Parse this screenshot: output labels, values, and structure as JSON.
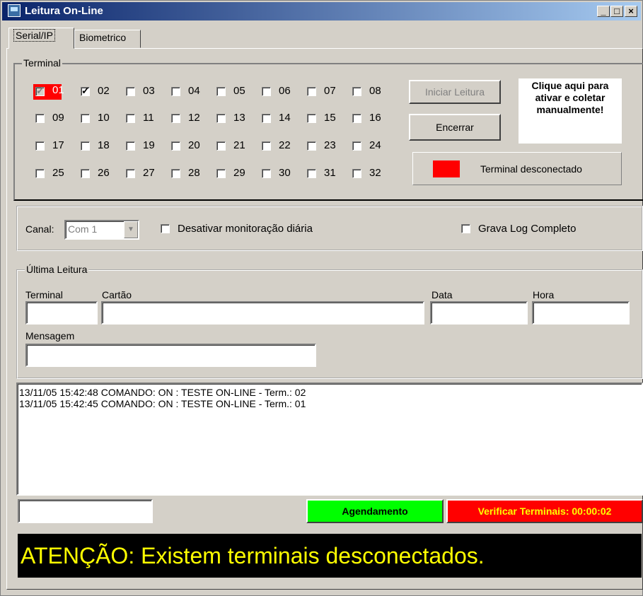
{
  "window": {
    "title": "Leitura On-Line"
  },
  "tabs": [
    {
      "label": "Serial/IP",
      "active": true
    },
    {
      "label": "Biometrico",
      "active": false
    }
  ],
  "terminal": {
    "legend": "Terminal",
    "items": [
      {
        "label": "01",
        "checked": true,
        "highlight": true
      },
      {
        "label": "02",
        "checked": true
      },
      {
        "label": "03"
      },
      {
        "label": "04"
      },
      {
        "label": "05"
      },
      {
        "label": "06"
      },
      {
        "label": "07"
      },
      {
        "label": "08"
      },
      {
        "label": "09"
      },
      {
        "label": "10"
      },
      {
        "label": "11"
      },
      {
        "label": "12"
      },
      {
        "label": "13"
      },
      {
        "label": "14"
      },
      {
        "label": "15"
      },
      {
        "label": "16"
      },
      {
        "label": "17"
      },
      {
        "label": "18"
      },
      {
        "label": "19"
      },
      {
        "label": "20"
      },
      {
        "label": "21"
      },
      {
        "label": "22"
      },
      {
        "label": "23"
      },
      {
        "label": "24"
      },
      {
        "label": "25"
      },
      {
        "label": "26"
      },
      {
        "label": "27"
      },
      {
        "label": "28"
      },
      {
        "label": "29"
      },
      {
        "label": "30"
      },
      {
        "label": "31"
      },
      {
        "label": "32"
      }
    ],
    "start_label": "Iniciar Leitura",
    "stop_label": "Encerrar",
    "manual_label": "Clique aqui para ativar e coletar manualmente!",
    "status_label": "Terminal desconectado",
    "status_color": "#ff0000"
  },
  "options": {
    "canal_label": "Canal:",
    "canal_value": "Com 1",
    "disable_label": "Desativar monitoração diária",
    "log_label": "Grava Log Completo"
  },
  "last_read": {
    "legend": "Última Leitura",
    "terminal_label": "Terminal",
    "card_label": "Cartão",
    "date_label": "Data",
    "time_label": "Hora",
    "message_label": "Mensagem"
  },
  "log_lines": [
    "13/11/05 15:42:48 COMANDO: ON : TESTE ON-LINE - Term.: 02",
    "13/11/05 15:42:45 COMANDO: ON : TESTE ON-LINE - Term.: 01"
  ],
  "footer": {
    "schedule_label": "Agendamento",
    "schedule_color": "#00ff00",
    "check_label": "Verificar Terminais: 00:00:02",
    "check_color": "#ff0000",
    "alert_text": "ATENÇÃO: Existem terminais desconectados.",
    "alert_color": "#ffff00"
  }
}
